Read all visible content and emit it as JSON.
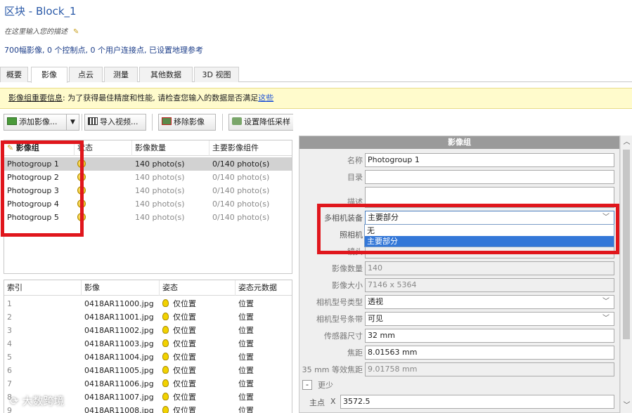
{
  "header": {
    "title": "区块 - Block_1",
    "description_placeholder": "在这里输入您的描述",
    "summary": "700幅影像, 0 个控制点, 0 个用户连接点, 已设置地理参考"
  },
  "tabs": [
    {
      "label": "概要",
      "active": false
    },
    {
      "label": "影像",
      "active": true
    },
    {
      "label": "点云",
      "active": false
    },
    {
      "label": "测量",
      "active": false
    },
    {
      "label": "其他数据",
      "active": false
    },
    {
      "label": "3D 视图",
      "active": false
    }
  ],
  "banner": {
    "title": "影像组重要信息",
    "text": ": 为了获得最佳精度和性能, 请检查您输入的数据是否满足",
    "link": "这些"
  },
  "toolbar": {
    "add_images": "添加影像...",
    "import_video": "导入视频...",
    "remove_images": "移除影像",
    "set_downsample": "设置降低采样"
  },
  "photogroups": {
    "columns": [
      "影像组",
      "状态",
      "影像数量",
      "主要影像组件"
    ],
    "rows": [
      {
        "name": "Photogroup 1",
        "count": "140 photo(s)",
        "main": "0/140 photo(s)",
        "selected": true
      },
      {
        "name": "Photogroup 2",
        "count": "140 photo(s)",
        "main": "0/140 photo(s)",
        "selected": false
      },
      {
        "name": "Photogroup 3",
        "count": "140 photo(s)",
        "main": "0/140 photo(s)",
        "selected": false
      },
      {
        "name": "Photogroup 4",
        "count": "140 photo(s)",
        "main": "0/140 photo(s)",
        "selected": false
      },
      {
        "name": "Photogroup 5",
        "count": "140 photo(s)",
        "main": "0/140 photo(s)",
        "selected": false
      }
    ]
  },
  "photos": {
    "columns": [
      "索引",
      "影像",
      "姿态",
      "姿态元数据"
    ],
    "rows": [
      {
        "index": "1",
        "file": "0418AR11000.jpg",
        "pose": "仅位置",
        "meta": "位置"
      },
      {
        "index": "2",
        "file": "0418AR11001.jpg",
        "pose": "仅位置",
        "meta": "位置"
      },
      {
        "index": "3",
        "file": "0418AR11002.jpg",
        "pose": "仅位置",
        "meta": "位置"
      },
      {
        "index": "4",
        "file": "0418AR11003.jpg",
        "pose": "仅位置",
        "meta": "位置"
      },
      {
        "index": "5",
        "file": "0418AR11004.jpg",
        "pose": "仅位置",
        "meta": "位置"
      },
      {
        "index": "6",
        "file": "0418AR11005.jpg",
        "pose": "仅位置",
        "meta": "位置"
      },
      {
        "index": "7",
        "file": "0418AR11006.jpg",
        "pose": "仅位置",
        "meta": "位置"
      },
      {
        "index": "8",
        "file": "0418AR11007.jpg",
        "pose": "仅位置",
        "meta": "位置"
      },
      {
        "index": "9",
        "file": "0418AR11008.jpg",
        "pose": "仅位置",
        "meta": "位置"
      }
    ]
  },
  "panel": {
    "title": "影像组",
    "name_label": "名称",
    "name_value": "Photogroup 1",
    "directory_label": "目录",
    "directory_value": "",
    "description_label": "描述",
    "description_value": "",
    "rig_label": "多相机装备",
    "rig_value": "主要部分",
    "rig_options": [
      "无",
      "主要部分"
    ],
    "rig_selected_option": "主要部分",
    "camera_label": "照相机",
    "lens_label": "镜头",
    "count_label": "影像数量",
    "count_value": "140",
    "size_label": "影像大小",
    "size_value": "7146 x 5364",
    "model_type_label": "相机型号类型",
    "model_type_value": "透视",
    "band_label": "相机型号条带",
    "band_value": "可见",
    "sensor_label": "传感器尺寸",
    "sensor_value": "32 mm",
    "focal_label": "焦距",
    "focal_value": "8.01563 mm",
    "equiv_label": "35 mm 等效焦距",
    "equiv_value": "9.01758 mm",
    "less_label": "更少",
    "principal_label": "主点",
    "principal_x_label": "X",
    "principal_x_value": "3572.5"
  },
  "watermark": "大数跨境",
  "colors": {
    "highlight_red": "#e0161c",
    "selection_blue": "#3377d8",
    "banner_yellow": "#fffbcc"
  }
}
